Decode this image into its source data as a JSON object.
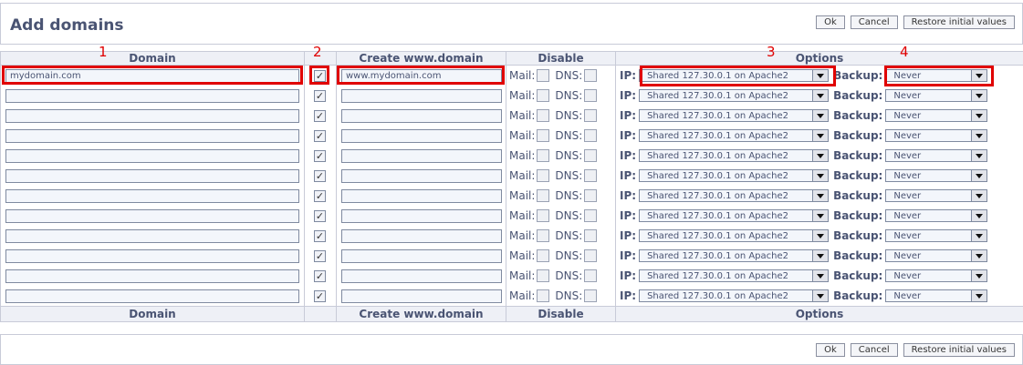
{
  "header": {
    "title": "Add domains"
  },
  "buttons": {
    "ok": "Ok",
    "cancel": "Cancel",
    "restore": "Restore initial values"
  },
  "columns": {
    "domain": "Domain",
    "www": "Create www.domain",
    "disable": "Disable",
    "options": "Options"
  },
  "labels": {
    "mail": "Mail:",
    "dns": "DNS:",
    "ip": "IP:",
    "backup": "Backup:"
  },
  "annotations": {
    "n1": "1",
    "n2": "2",
    "n3": "3",
    "n4": "4"
  },
  "colors": {
    "accent": "#4a5473",
    "highlight": "#e00000"
  },
  "rows": [
    {
      "domain": "mydomain.com",
      "www_checked": true,
      "www": "www.mydomain.com",
      "ip": "Shared 127.30.0.1 on Apache2",
      "backup": "Never"
    },
    {
      "domain": "",
      "www_checked": true,
      "www": "",
      "ip": "Shared 127.30.0.1 on Apache2",
      "backup": "Never"
    },
    {
      "domain": "",
      "www_checked": true,
      "www": "",
      "ip": "Shared 127.30.0.1 on Apache2",
      "backup": "Never"
    },
    {
      "domain": "",
      "www_checked": true,
      "www": "",
      "ip": "Shared 127.30.0.1 on Apache2",
      "backup": "Never"
    },
    {
      "domain": "",
      "www_checked": true,
      "www": "",
      "ip": "Shared 127.30.0.1 on Apache2",
      "backup": "Never"
    },
    {
      "domain": "",
      "www_checked": true,
      "www": "",
      "ip": "Shared 127.30.0.1 on Apache2",
      "backup": "Never"
    },
    {
      "domain": "",
      "www_checked": true,
      "www": "",
      "ip": "Shared 127.30.0.1 on Apache2",
      "backup": "Never"
    },
    {
      "domain": "",
      "www_checked": true,
      "www": "",
      "ip": "Shared 127.30.0.1 on Apache2",
      "backup": "Never"
    },
    {
      "domain": "",
      "www_checked": true,
      "www": "",
      "ip": "Shared 127.30.0.1 on Apache2",
      "backup": "Never"
    },
    {
      "domain": "",
      "www_checked": true,
      "www": "",
      "ip": "Shared 127.30.0.1 on Apache2",
      "backup": "Never"
    },
    {
      "domain": "",
      "www_checked": true,
      "www": "",
      "ip": "Shared 127.30.0.1 on Apache2",
      "backup": "Never"
    },
    {
      "domain": "",
      "www_checked": true,
      "www": "",
      "ip": "Shared 127.30.0.1 on Apache2",
      "backup": "Never"
    }
  ]
}
